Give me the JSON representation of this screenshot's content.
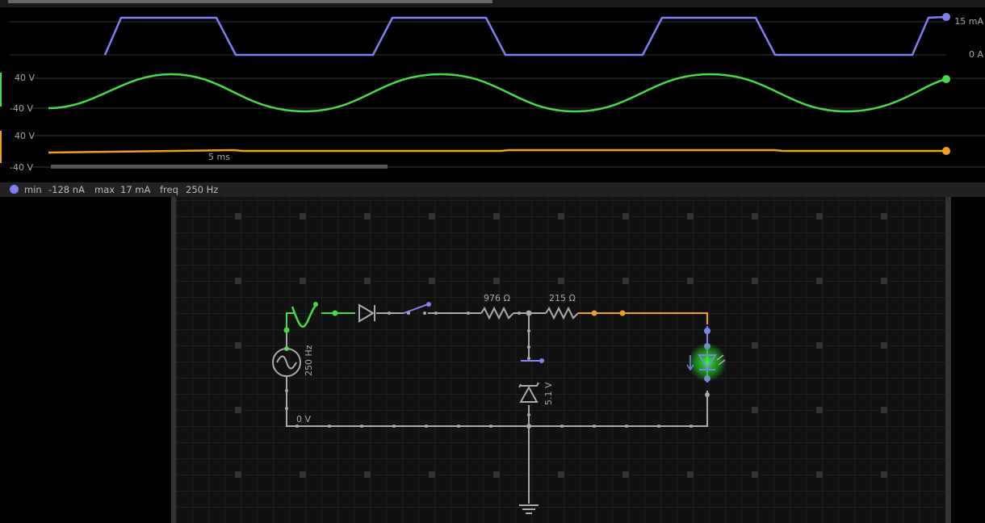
{
  "scope": {
    "top_scrollbar": {
      "position": 0.5
    },
    "traces": [
      {
        "name": "trace-current",
        "color": "#8080f0",
        "max_label": "15 mA",
        "min_label": "0 A"
      },
      {
        "name": "trace-voltage-1",
        "color": "#44dd44",
        "max_label": "40 V",
        "min_label": "-40 V"
      },
      {
        "name": "trace-voltage-2",
        "color": "#f0a020",
        "max_label": "40 V",
        "min_label": "-40 V"
      }
    ],
    "time_label": "5 ms"
  },
  "info": {
    "dot_color": "#8080f0",
    "min_label": "min",
    "min_value": "-128 nA",
    "max_label": "max",
    "max_value": "17 mA",
    "freq_label": "freq",
    "freq_value": "250 Hz"
  },
  "circuit": {
    "source_label": "250 Hz",
    "ground_node_label": "0 V",
    "r1_label": "976 Ω",
    "r2_label": "215 Ω",
    "zener_label": "5.1 V",
    "colors": {
      "grid": "#2a2a2a",
      "wire": "#aaaaaa",
      "live": "#44dd44",
      "current": "#8080f0",
      "orange": "#f0a020"
    }
  }
}
